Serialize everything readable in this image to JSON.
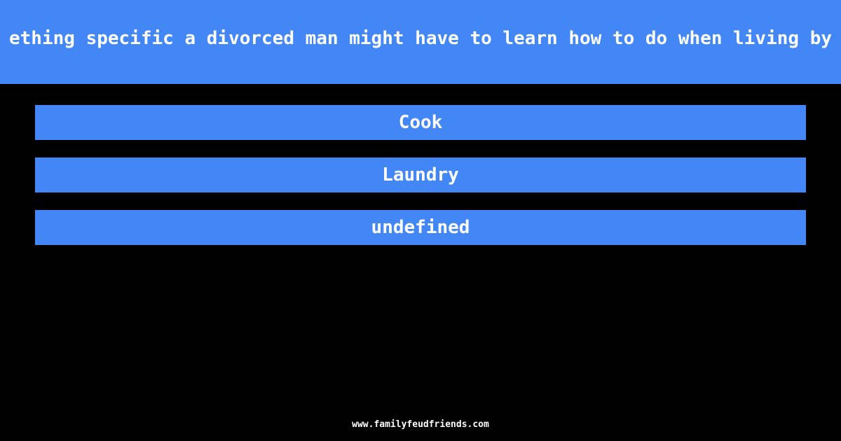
{
  "question": "ething specific a divorced man might have to learn how to do when living by",
  "answers": [
    {
      "label": "Cook"
    },
    {
      "label": "Laundry"
    },
    {
      "label": "undefined"
    }
  ],
  "footer": {
    "site": "www.familyfeudfriends.com"
  },
  "colors": {
    "accent": "#4287f5",
    "background": "#000000",
    "text": "#ffffff"
  }
}
